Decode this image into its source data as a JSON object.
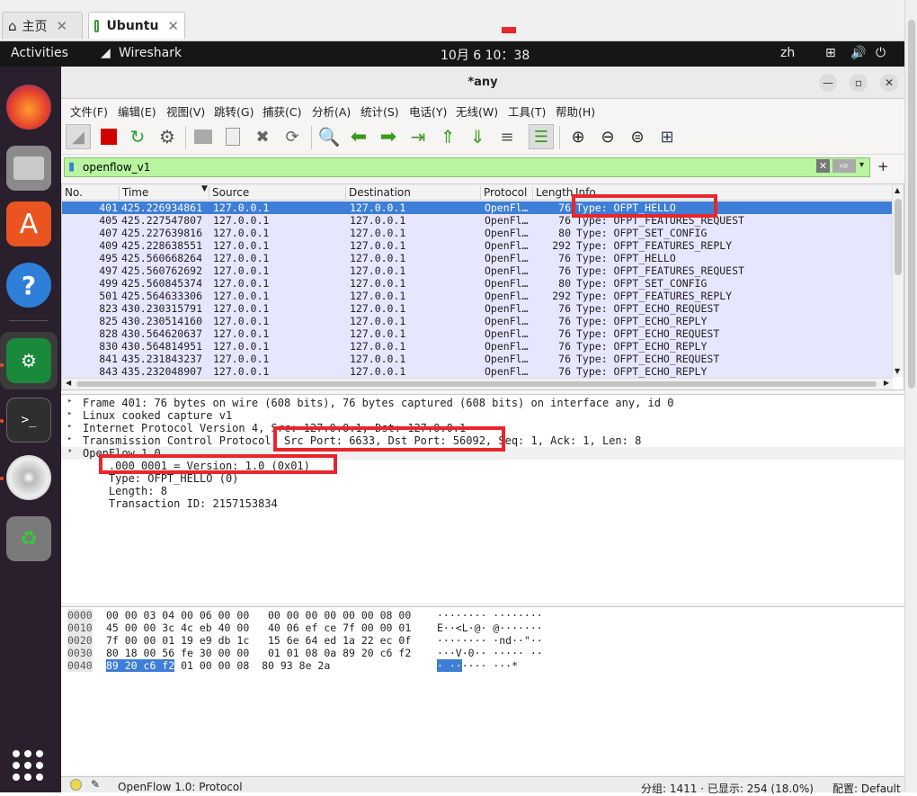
{
  "host_tabs": [
    {
      "label": "主页",
      "icon": "home-icon"
    },
    {
      "label": "Ubuntu",
      "icon": "vm-icon"
    }
  ],
  "topbar": {
    "activities": "Activities",
    "app": "Wireshark",
    "clock": "10月 6  10：38",
    "lang": "zh"
  },
  "window": {
    "title": "*any"
  },
  "menu": [
    "文件(F)",
    "编辑(E)",
    "视图(V)",
    "跳转(G)",
    "捕获(C)",
    "分析(A)",
    "统计(S)",
    "电话(Y)",
    "无线(W)",
    "工具(T)",
    "帮助(H)"
  ],
  "filter": {
    "value": "openflow_v1"
  },
  "packet_list": {
    "columns": [
      "No.",
      "Time",
      "Source",
      "Destination",
      "Protocol",
      "Length",
      "Info"
    ],
    "rows": [
      {
        "no": "401",
        "time": "425.226934861",
        "src": "127.0.0.1",
        "dst": "127.0.0.1",
        "proto": "OpenFl…",
        "len": "76",
        "info": "Type: OFPT_HELLO",
        "selected": true
      },
      {
        "no": "405",
        "time": "425.227547807",
        "src": "127.0.0.1",
        "dst": "127.0.0.1",
        "proto": "OpenFl…",
        "len": "76",
        "info": "Type: OFPT_FEATURES_REQUEST"
      },
      {
        "no": "407",
        "time": "425.227639816",
        "src": "127.0.0.1",
        "dst": "127.0.0.1",
        "proto": "OpenFl…",
        "len": "80",
        "info": "Type: OFPT_SET_CONFIG"
      },
      {
        "no": "409",
        "time": "425.228638551",
        "src": "127.0.0.1",
        "dst": "127.0.0.1",
        "proto": "OpenFl…",
        "len": "292",
        "info": "Type: OFPT_FEATURES_REPLY"
      },
      {
        "no": "495",
        "time": "425.560668264",
        "src": "127.0.0.1",
        "dst": "127.0.0.1",
        "proto": "OpenFl…",
        "len": "76",
        "info": "Type: OFPT_HELLO"
      },
      {
        "no": "497",
        "time": "425.560762692",
        "src": "127.0.0.1",
        "dst": "127.0.0.1",
        "proto": "OpenFl…",
        "len": "76",
        "info": "Type: OFPT_FEATURES_REQUEST"
      },
      {
        "no": "499",
        "time": "425.560845374",
        "src": "127.0.0.1",
        "dst": "127.0.0.1",
        "proto": "OpenFl…",
        "len": "80",
        "info": "Type: OFPT_SET_CONFIG"
      },
      {
        "no": "501",
        "time": "425.564633306",
        "src": "127.0.0.1",
        "dst": "127.0.0.1",
        "proto": "OpenFl…",
        "len": "292",
        "info": "Type: OFPT_FEATURES_REPLY"
      },
      {
        "no": "823",
        "time": "430.230315791",
        "src": "127.0.0.1",
        "dst": "127.0.0.1",
        "proto": "OpenFl…",
        "len": "76",
        "info": "Type: OFPT_ECHO_REQUEST"
      },
      {
        "no": "825",
        "time": "430.230514160",
        "src": "127.0.0.1",
        "dst": "127.0.0.1",
        "proto": "OpenFl…",
        "len": "76",
        "info": "Type: OFPT_ECHO_REPLY"
      },
      {
        "no": "828",
        "time": "430.564620637",
        "src": "127.0.0.1",
        "dst": "127.0.0.1",
        "proto": "OpenFl…",
        "len": "76",
        "info": "Type: OFPT_ECHO_REQUEST"
      },
      {
        "no": "830",
        "time": "430.564814951",
        "src": "127.0.0.1",
        "dst": "127.0.0.1",
        "proto": "OpenFl…",
        "len": "76",
        "info": "Type: OFPT_ECHO_REPLY"
      },
      {
        "no": "841",
        "time": "435.231843237",
        "src": "127.0.0.1",
        "dst": "127.0.0.1",
        "proto": "OpenFl…",
        "len": "76",
        "info": "Type: OFPT_ECHO_REQUEST"
      },
      {
        "no": "843",
        "time": "435.232048907",
        "src": "127.0.0.1",
        "dst": "127.0.0.1",
        "proto": "OpenFl…",
        "len": "76",
        "info": "Type: OFPT_ECHO_REPLY"
      }
    ]
  },
  "details": [
    {
      "text": "Frame 401: 76 bytes on wire (608 bits), 76 bytes captured (608 bits) on interface any, id 0",
      "arrow": "▸"
    },
    {
      "text": "Linux cooked capture v1",
      "arrow": "▸"
    },
    {
      "text": "Internet Protocol Version 4, Src: 127.0.0.1, Dst: 127.0.0.1",
      "arrow": "▸"
    },
    {
      "text": "Transmission Control Protocol, Src Port: 6633, Dst Port: 56092, Seq: 1, Ack: 1, Len: 8",
      "arrow": "▸"
    },
    {
      "text": "OpenFlow 1.0",
      "arrow": "▾"
    },
    {
      "text": "    .000 0001 = Version: 1.0 (0x01)",
      "arrow": ""
    },
    {
      "text": "    Type: OFPT_HELLO (0)",
      "arrow": ""
    },
    {
      "text": "    Length: 8",
      "arrow": ""
    },
    {
      "text": "    Transaction ID: 2157153834",
      "arrow": ""
    }
  ],
  "bytes": [
    {
      "off": "0000",
      "hex": "00 00 03 04 00 06 00 00   00 00 00 00 00 00 08 00",
      "asc": "········ ········"
    },
    {
      "off": "0010",
      "hex": "45 00 00 3c 4c eb 40 00   40 06 ef ce 7f 00 00 01",
      "asc": "E··<L·@· @·······"
    },
    {
      "off": "0020",
      "hex": "7f 00 00 01 19 e9 db 1c   15 6e 64 ed 1a 22 ec 0f",
      "asc": "········ ·nd··\"··"
    },
    {
      "off": "0030",
      "hex": "80 18 00 56 fe 30 00 00   01 01 08 0a 89 20 c6 f2",
      "asc": "···V·0·· ····· ··"
    },
    {
      "off": "0040",
      "hex_sel": "89 20 c6 f2",
      "hex": " 01 00 00 08  80 93 8e 2a",
      "asc_sel": "· ··",
      "asc": "···· ···*"
    }
  ],
  "status": {
    "protocol": "OpenFlow 1.0: Protocol",
    "counts": "分组: 1411 · 已显示: 254 (18.0%)",
    "profile": "配置: Default"
  },
  "colors": {
    "selected": "#3e7ed6",
    "row_bg": "#e7e6ff",
    "filter_bg": "#b8f5a0",
    "annotation": "#e8262b"
  }
}
